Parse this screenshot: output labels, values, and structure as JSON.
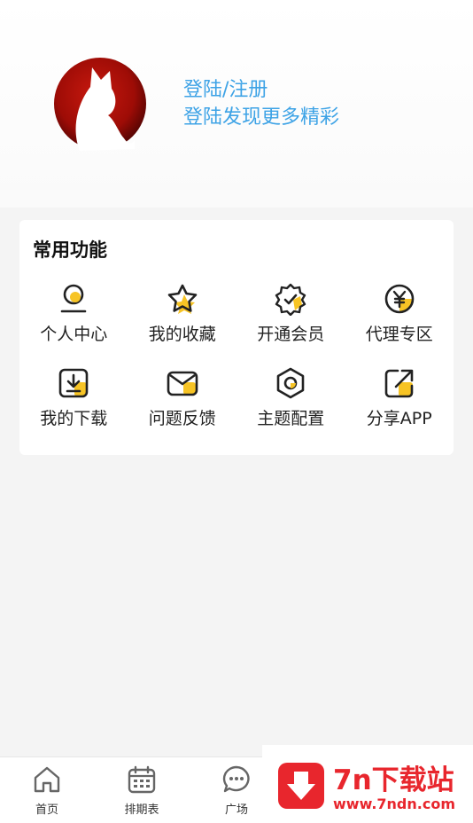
{
  "header": {
    "login_title": "登陆/注册",
    "login_subtitle": "登陆发现更多精彩"
  },
  "features": {
    "title": "常用功能",
    "items": [
      {
        "label": "个人中心",
        "icon": "user-icon"
      },
      {
        "label": "我的收藏",
        "icon": "star-icon"
      },
      {
        "label": "开通会员",
        "icon": "vip-badge-icon"
      },
      {
        "label": "代理专区",
        "icon": "yuan-icon"
      },
      {
        "label": "我的下载",
        "icon": "download-icon"
      },
      {
        "label": "问题反馈",
        "icon": "mail-icon"
      },
      {
        "label": "主题配置",
        "icon": "theme-icon"
      },
      {
        "label": "分享APP",
        "icon": "share-icon"
      }
    ]
  },
  "bottom_nav": {
    "items": [
      {
        "label": "首页",
        "icon": "home-icon"
      },
      {
        "label": "排期表",
        "icon": "calendar-icon"
      },
      {
        "label": "广场",
        "icon": "chat-icon"
      }
    ]
  },
  "watermark": {
    "title": "7n下载站",
    "url": "www.7ndn.com"
  },
  "colors": {
    "accent_blue": "#3ea3e6",
    "icon_yellow": "#f7c425",
    "watermark_red": "#e8262d"
  }
}
